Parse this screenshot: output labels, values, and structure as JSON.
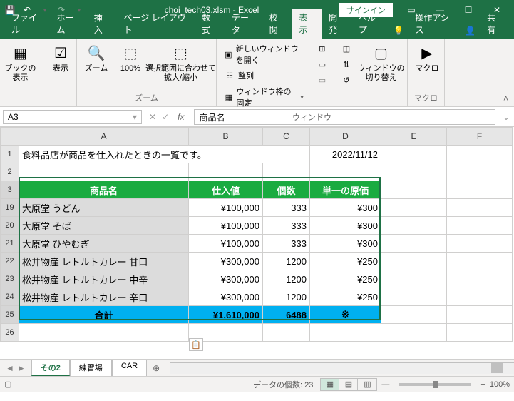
{
  "title": "choi_tech03.xlsm - Excel",
  "signin": "サインイン",
  "tabs": {
    "file": "ファイル",
    "home": "ホーム",
    "insert": "挿入",
    "layout": "ページ レイアウト",
    "formulas": "数式",
    "data": "データ",
    "review": "校閲",
    "view": "表示",
    "dev": "開発",
    "help": "ヘルプ",
    "tellme": "操作アシス",
    "share": "共有"
  },
  "ribbon": {
    "bookview": "ブックの\n表示",
    "show": "表示",
    "zoom": "ズーム",
    "hundred": "100%",
    "zoom_selection": "選択範囲に合わせて\n拡大/縮小",
    "zoom_group": "ズーム",
    "new_window": "新しいウィンドウを開く",
    "arrange": "整列",
    "freeze": "ウィンドウ枠の固定",
    "switch_window": "ウィンドウの\n切り替え",
    "window_group": "ウィンドウ",
    "macro": "マクロ",
    "macro_group": "マクロ"
  },
  "namebox": "A3",
  "formula_value": "商品名",
  "cols": [
    "A",
    "B",
    "C",
    "D",
    "E",
    "F"
  ],
  "info_row": {
    "r": "1",
    "text": "食料品店が商品を仕入れたときの一覧です。",
    "date": "2022/11/12"
  },
  "blank_row": "2",
  "header": {
    "r": "3",
    "name": "商品名",
    "cost": "仕入値",
    "qty": "個数",
    "unit": "単一の原価"
  },
  "rows": [
    {
      "r": "19",
      "name": "大原堂 うどん",
      "cost": "¥100,000",
      "qty": "333",
      "unit": "¥300"
    },
    {
      "r": "20",
      "name": "大原堂 そば",
      "cost": "¥100,000",
      "qty": "333",
      "unit": "¥300"
    },
    {
      "r": "21",
      "name": "大原堂 ひやむぎ",
      "cost": "¥100,000",
      "qty": "333",
      "unit": "¥300"
    },
    {
      "r": "22",
      "name": "松井物産 レトルトカレー 甘口",
      "cost": "¥300,000",
      "qty": "1200",
      "unit": "¥250"
    },
    {
      "r": "23",
      "name": "松井物産 レトルトカレー 中辛",
      "cost": "¥300,000",
      "qty": "1200",
      "unit": "¥250"
    },
    {
      "r": "24",
      "name": "松井物産 レトルトカレー 辛口",
      "cost": "¥300,000",
      "qty": "1200",
      "unit": "¥250"
    }
  ],
  "total": {
    "r": "25",
    "label": "合計",
    "cost": "¥1,610,000",
    "qty": "6488",
    "unit": "※"
  },
  "after_row": "26",
  "sheets": {
    "s1": "その2",
    "s2": "練習場",
    "s3": "CAR"
  },
  "status": {
    "count": "データの個数: 23",
    "zoom": "100%"
  },
  "chart_data": null
}
